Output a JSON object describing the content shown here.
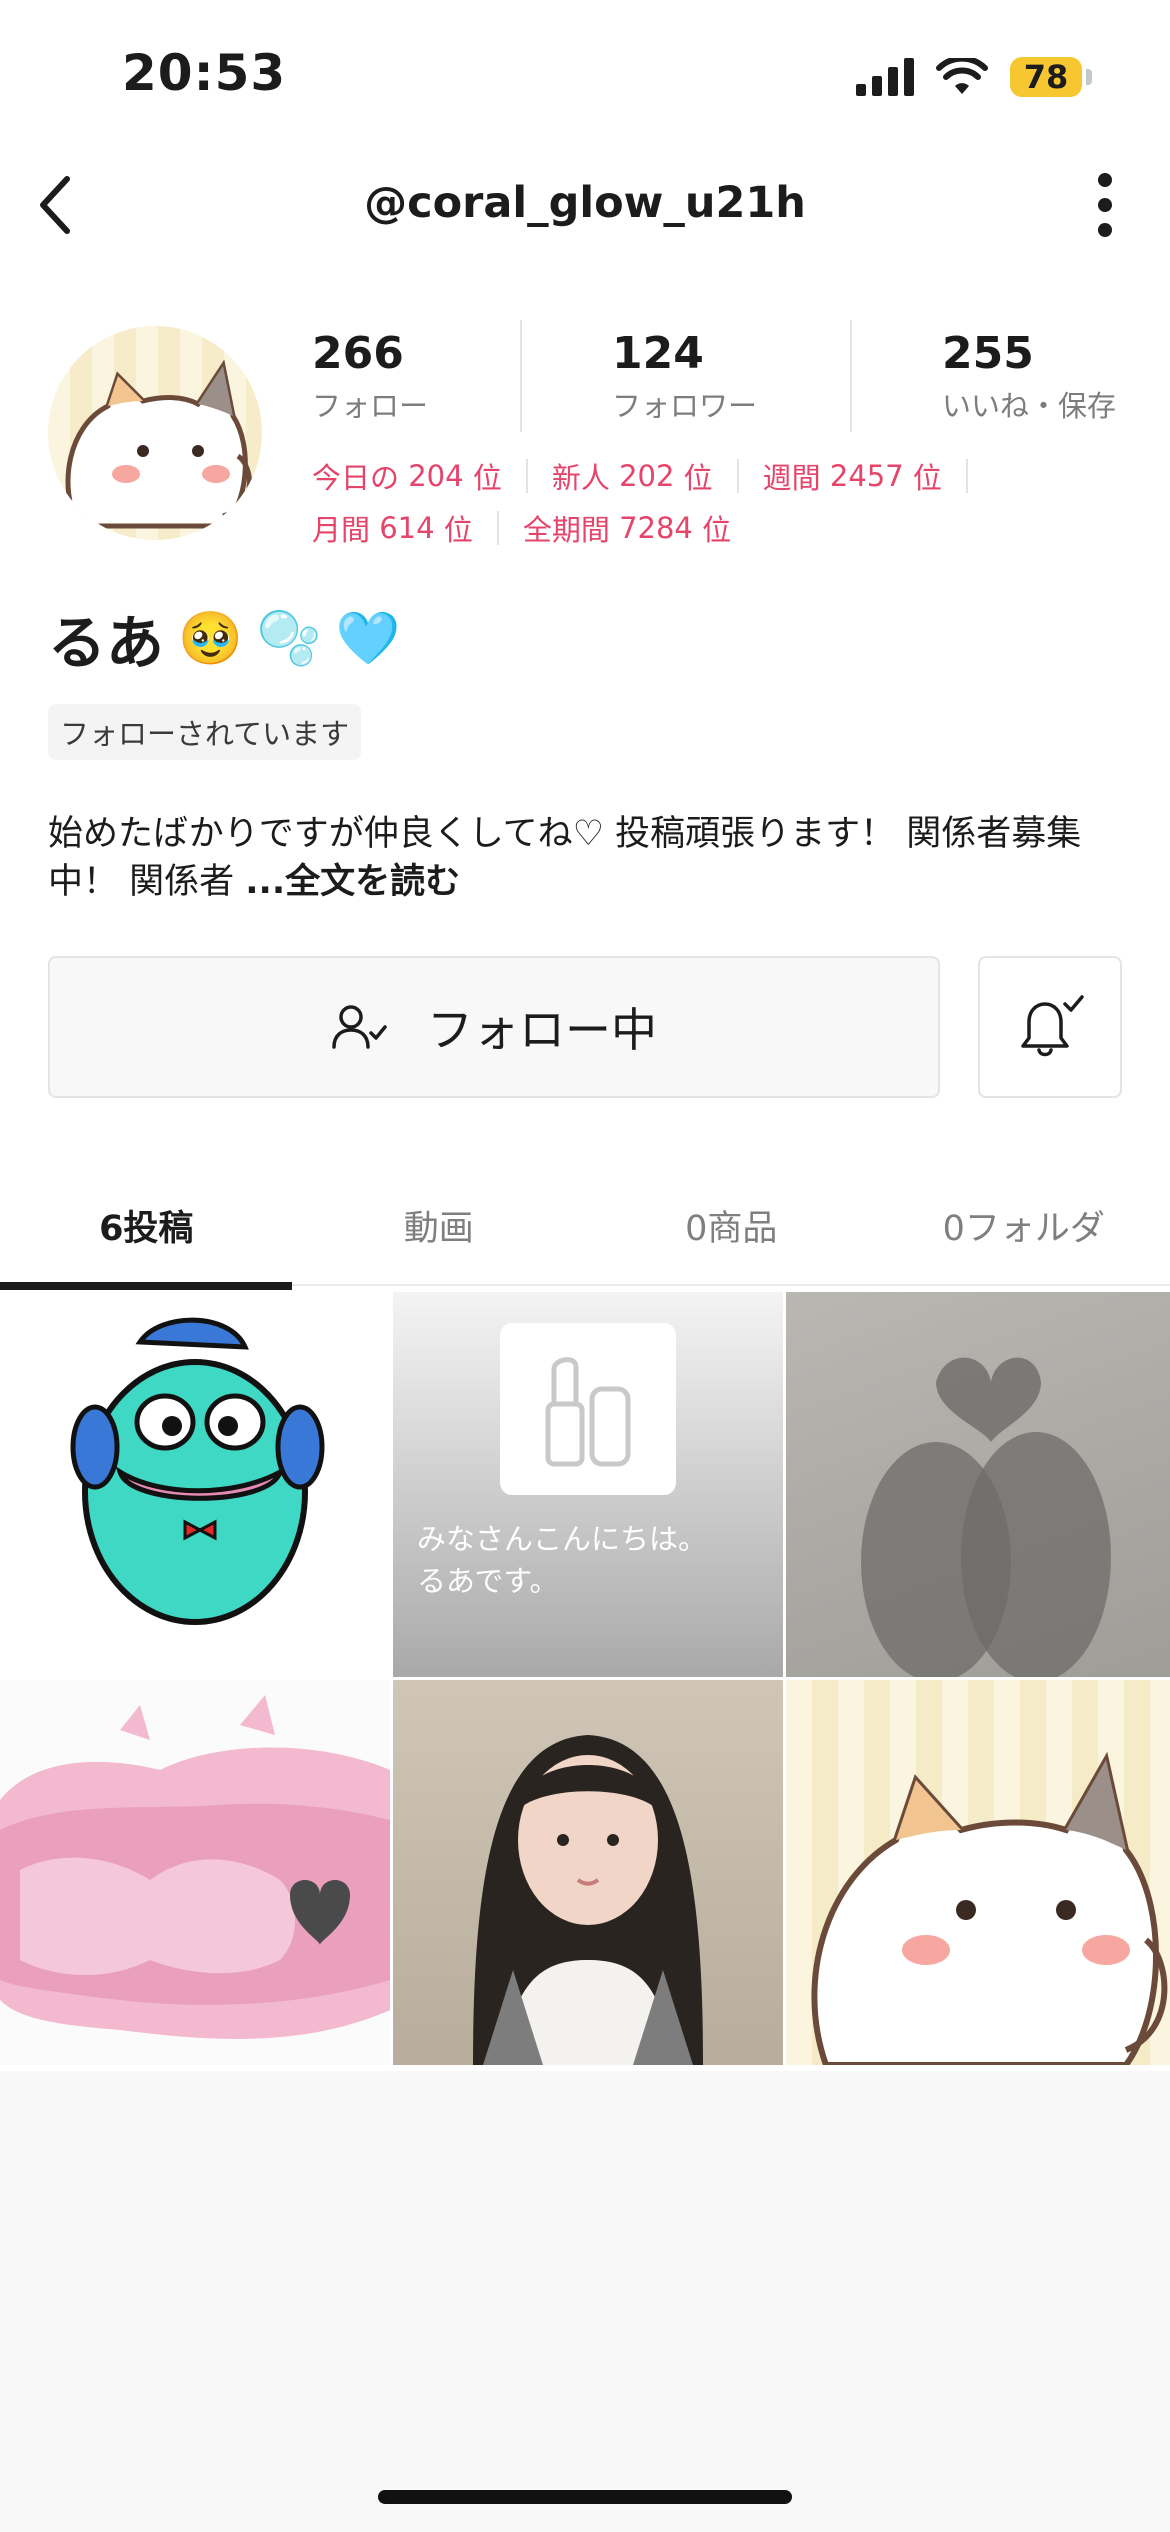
{
  "status_bar": {
    "time": "20:53",
    "battery": "78",
    "battery_color": "#f6c731"
  },
  "nav": {
    "username": "@coral_glow_u21h"
  },
  "stats": [
    {
      "value": "266",
      "label": "フォロー"
    },
    {
      "value": "124",
      "label": "フォロワー"
    },
    {
      "value": "255",
      "label": "いいね・保存"
    }
  ],
  "ranks": [
    {
      "label": "今日の",
      "value": "204",
      "unit": "位"
    },
    {
      "label": "新人",
      "value": "202",
      "unit": "位"
    },
    {
      "label": "週間",
      "value": "2457",
      "unit": "位"
    },
    {
      "label": "月間",
      "value": "614",
      "unit": "位"
    },
    {
      "label": "全期間",
      "value": "7284",
      "unit": "位"
    }
  ],
  "rank_color": "#e5446b",
  "profile": {
    "name": "るあ",
    "emojis": [
      "🥹",
      "🫧",
      "🩵"
    ],
    "follow_badge": "フォローされています",
    "bio_line1": "始めたばかりですが仲良くしてね♡ 投稿頑張ります！ 関係者募集",
    "bio_line2": "中！ 関係者 ",
    "bio_more": "...全文を読む"
  },
  "buttons": {
    "following": "フォロー中"
  },
  "tabs": [
    {
      "count": "6",
      "label": "投稿",
      "active": true
    },
    {
      "count": "",
      "label": "動画",
      "active": false
    },
    {
      "count": "0",
      "label": "商品",
      "active": false
    },
    {
      "count": "0",
      "label": "フォルダ",
      "active": false
    }
  ],
  "posts": {
    "text_post_line1": "みなさんこんにちは。",
    "text_post_line2": "るあです。"
  }
}
